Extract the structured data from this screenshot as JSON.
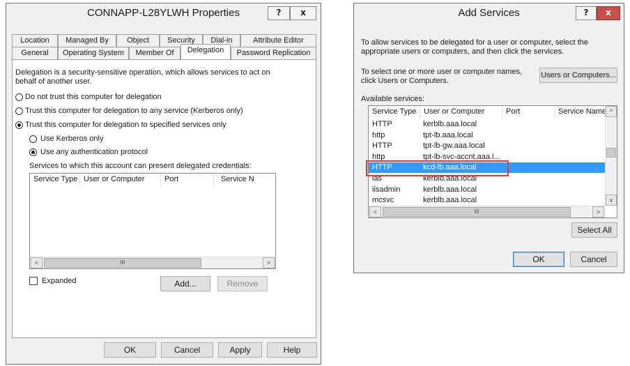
{
  "properties": {
    "title": "CONNAPP-L28YLWH Properties",
    "help_glyph": "?",
    "close_glyph": "x",
    "tabs_row1": [
      "Location",
      "Managed By",
      "Object",
      "Security",
      "Dial-in",
      "Attribute Editor"
    ],
    "tabs_row2": [
      "General",
      "Operating System",
      "Member Of",
      "Delegation",
      "Password Replication"
    ],
    "active_tab": "Delegation",
    "intro": "Delegation is a security-sensitive operation, which allows services to act on behalf of another user.",
    "opt_none": "Do not trust this computer for delegation",
    "opt_any": "Trust this computer for delegation to any service (Kerberos only)",
    "opt_specified": "Trust this computer for delegation to specified services only",
    "opt_kerberos": "Use Kerberos only",
    "opt_anyauth": "Use any authentication protocol",
    "services_label": "Services to which this account can present delegated credentials:",
    "columns": [
      "Service Type",
      "User or Computer",
      "Port",
      "Service N"
    ],
    "expanded": "Expanded",
    "add": "Add...",
    "remove": "Remove",
    "ok": "OK",
    "cancel": "Cancel",
    "apply": "Apply",
    "help": "Help",
    "scroll_left": "<",
    "scroll_right": ">",
    "thumb_grip": "III"
  },
  "add_services": {
    "title": "Add Services",
    "help_glyph": "?",
    "close_glyph": "x",
    "instruction": "To allow services to be delegated for a user or computer, select the appropriate users or computers, and then click the services.",
    "select_text": "To select one or more user or computer names, click Users or Computers.",
    "users_btn": "Users or Computers...",
    "available_label": "Available services:",
    "columns": [
      "Service Type",
      "User or Computer",
      "Port",
      "Service Name"
    ],
    "rows": [
      {
        "type": "HTTP",
        "host": "kerblb.aaa.local"
      },
      {
        "type": "http",
        "host": "tpt-lb.aaa.local"
      },
      {
        "type": "HTTP",
        "host": "tpt-lb-gw.aaa.local"
      },
      {
        "type": "http",
        "host": "tpt-lb-svc-accnt.aaa.l..."
      },
      {
        "type": "HTTP",
        "host": "kcd-lb.aaa.local"
      },
      {
        "type": "ias",
        "host": "kerblb.aaa.local"
      },
      {
        "type": "iisadmin",
        "host": "kerblb.aaa.local"
      },
      {
        "type": "mcsvc",
        "host": "kerblb.aaa.local"
      }
    ],
    "selected_index": 4,
    "select_all": "Select All",
    "ok": "OK",
    "cancel": "Cancel",
    "scroll_up": "^",
    "scroll_down": "v",
    "scroll_left": "<",
    "scroll_right": ">",
    "thumb_grip": "III",
    "highlight_color": "#e53935"
  }
}
